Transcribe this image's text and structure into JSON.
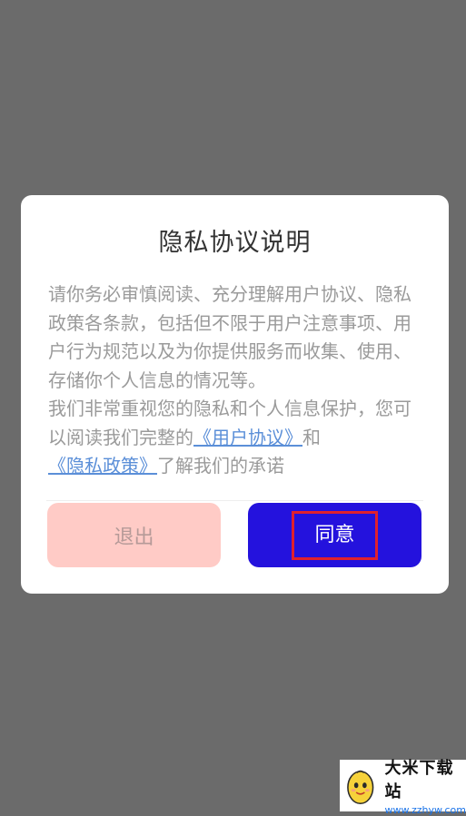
{
  "dialog": {
    "title": "隐私协议说明",
    "paragraph1": "请你务必审慎阅读、充分理解用户协议、隐私政策各条款，包括但不限于用户注意事项、用户行为规范以及为你提供服务而收集、使用、存储你个人信息的情况等。",
    "paragraph2_prefix": "我们非常重视您的隐私和个人信息保护，您可以阅读我们完整的",
    "user_agreement_link": "《用户协议》",
    "and_text": "和",
    "privacy_policy_link": "《隐私政策》",
    "paragraph2_suffix": "了解我们的承诺",
    "exit_label": "退出",
    "agree_label": "同意"
  },
  "watermark": {
    "name": "大米下载站",
    "url": "www.zzhyw.com",
    "logo_icon": "egg-mascot-icon"
  },
  "colors": {
    "overlay": "#6b6b6b",
    "agree_button": "#2412dd",
    "exit_button": "#ffcbc6",
    "highlight_border": "#e0202e",
    "link": "#5b8fd8"
  }
}
